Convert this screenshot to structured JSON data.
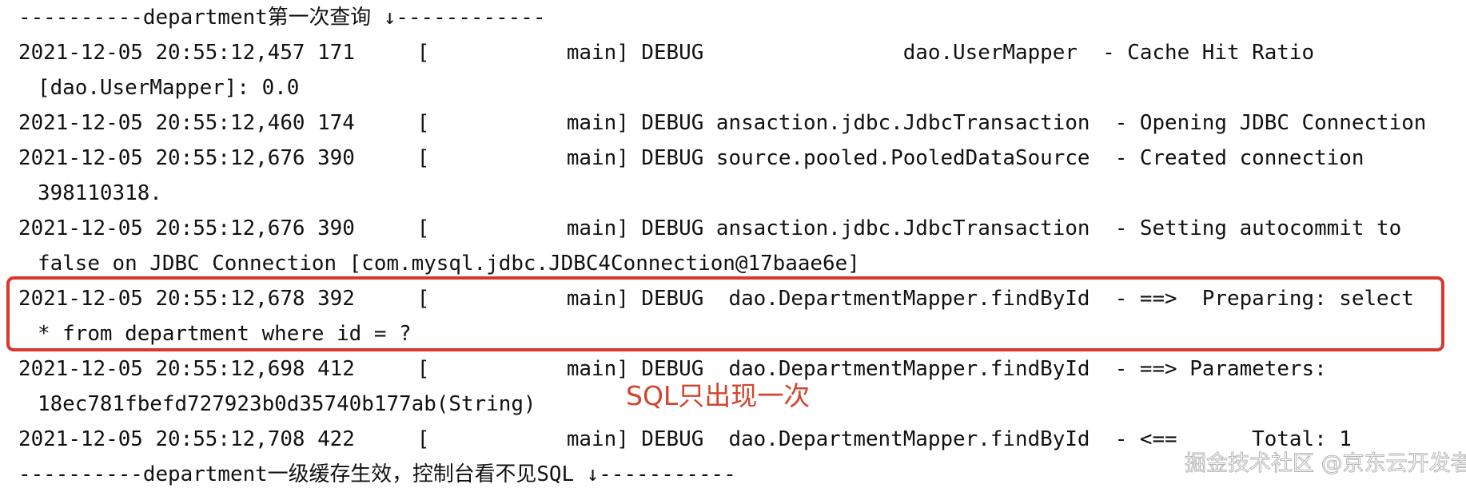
{
  "console": {
    "lines": [
      {
        "kind": "separator",
        "text": "----------department第一次查询 ↓------------"
      },
      {
        "kind": "log",
        "text": "2021-12-05 20:55:12,457 171     [           main] DEBUG                dao.UserMapper  - Cache Hit Ratio"
      },
      {
        "kind": "cont",
        "text": "[dao.UserMapper]: 0.0"
      },
      {
        "kind": "log",
        "text": "2021-12-05 20:55:12,460 174     [           main] DEBUG ansaction.jdbc.JdbcTransaction  - Opening JDBC Connection"
      },
      {
        "kind": "log",
        "text": "2021-12-05 20:55:12,676 390     [           main] DEBUG source.pooled.PooledDataSource  - Created connection"
      },
      {
        "kind": "cont",
        "text": "398110318."
      },
      {
        "kind": "log",
        "text": "2021-12-05 20:55:12,676 390     [           main] DEBUG ansaction.jdbc.JdbcTransaction  - Setting autocommit to"
      },
      {
        "kind": "cont",
        "text": "false on JDBC Connection [com.mysql.jdbc.JDBC4Connection@17baae6e]"
      },
      {
        "kind": "log",
        "text": "2021-12-05 20:55:12,678 392     [           main] DEBUG  dao.DepartmentMapper.findById  - ==>  Preparing: select"
      },
      {
        "kind": "cont",
        "text": "* from department where id = ?"
      },
      {
        "kind": "log",
        "text": "2021-12-05 20:55:12,698 412     [           main] DEBUG  dao.DepartmentMapper.findById  - ==> Parameters:"
      },
      {
        "kind": "cont",
        "text": "18ec781fbefd727923b0d35740b177ab(String)"
      },
      {
        "kind": "log",
        "text": "2021-12-05 20:55:12,708 422     [           main] DEBUG  dao.DepartmentMapper.findById  - <==      Total: 1"
      },
      {
        "kind": "separator",
        "text": "----------department一级缓存生效，控制台看不见SQL ↓-----------"
      }
    ]
  },
  "highlight": {
    "color": "#d9372b",
    "covers": "Preparing: select * from department where id = ?"
  },
  "annotation": {
    "text": "SQL只出现一次",
    "color": "#d0462f"
  },
  "watermark": {
    "text": "掘金技术社区 @京东云开发者"
  }
}
